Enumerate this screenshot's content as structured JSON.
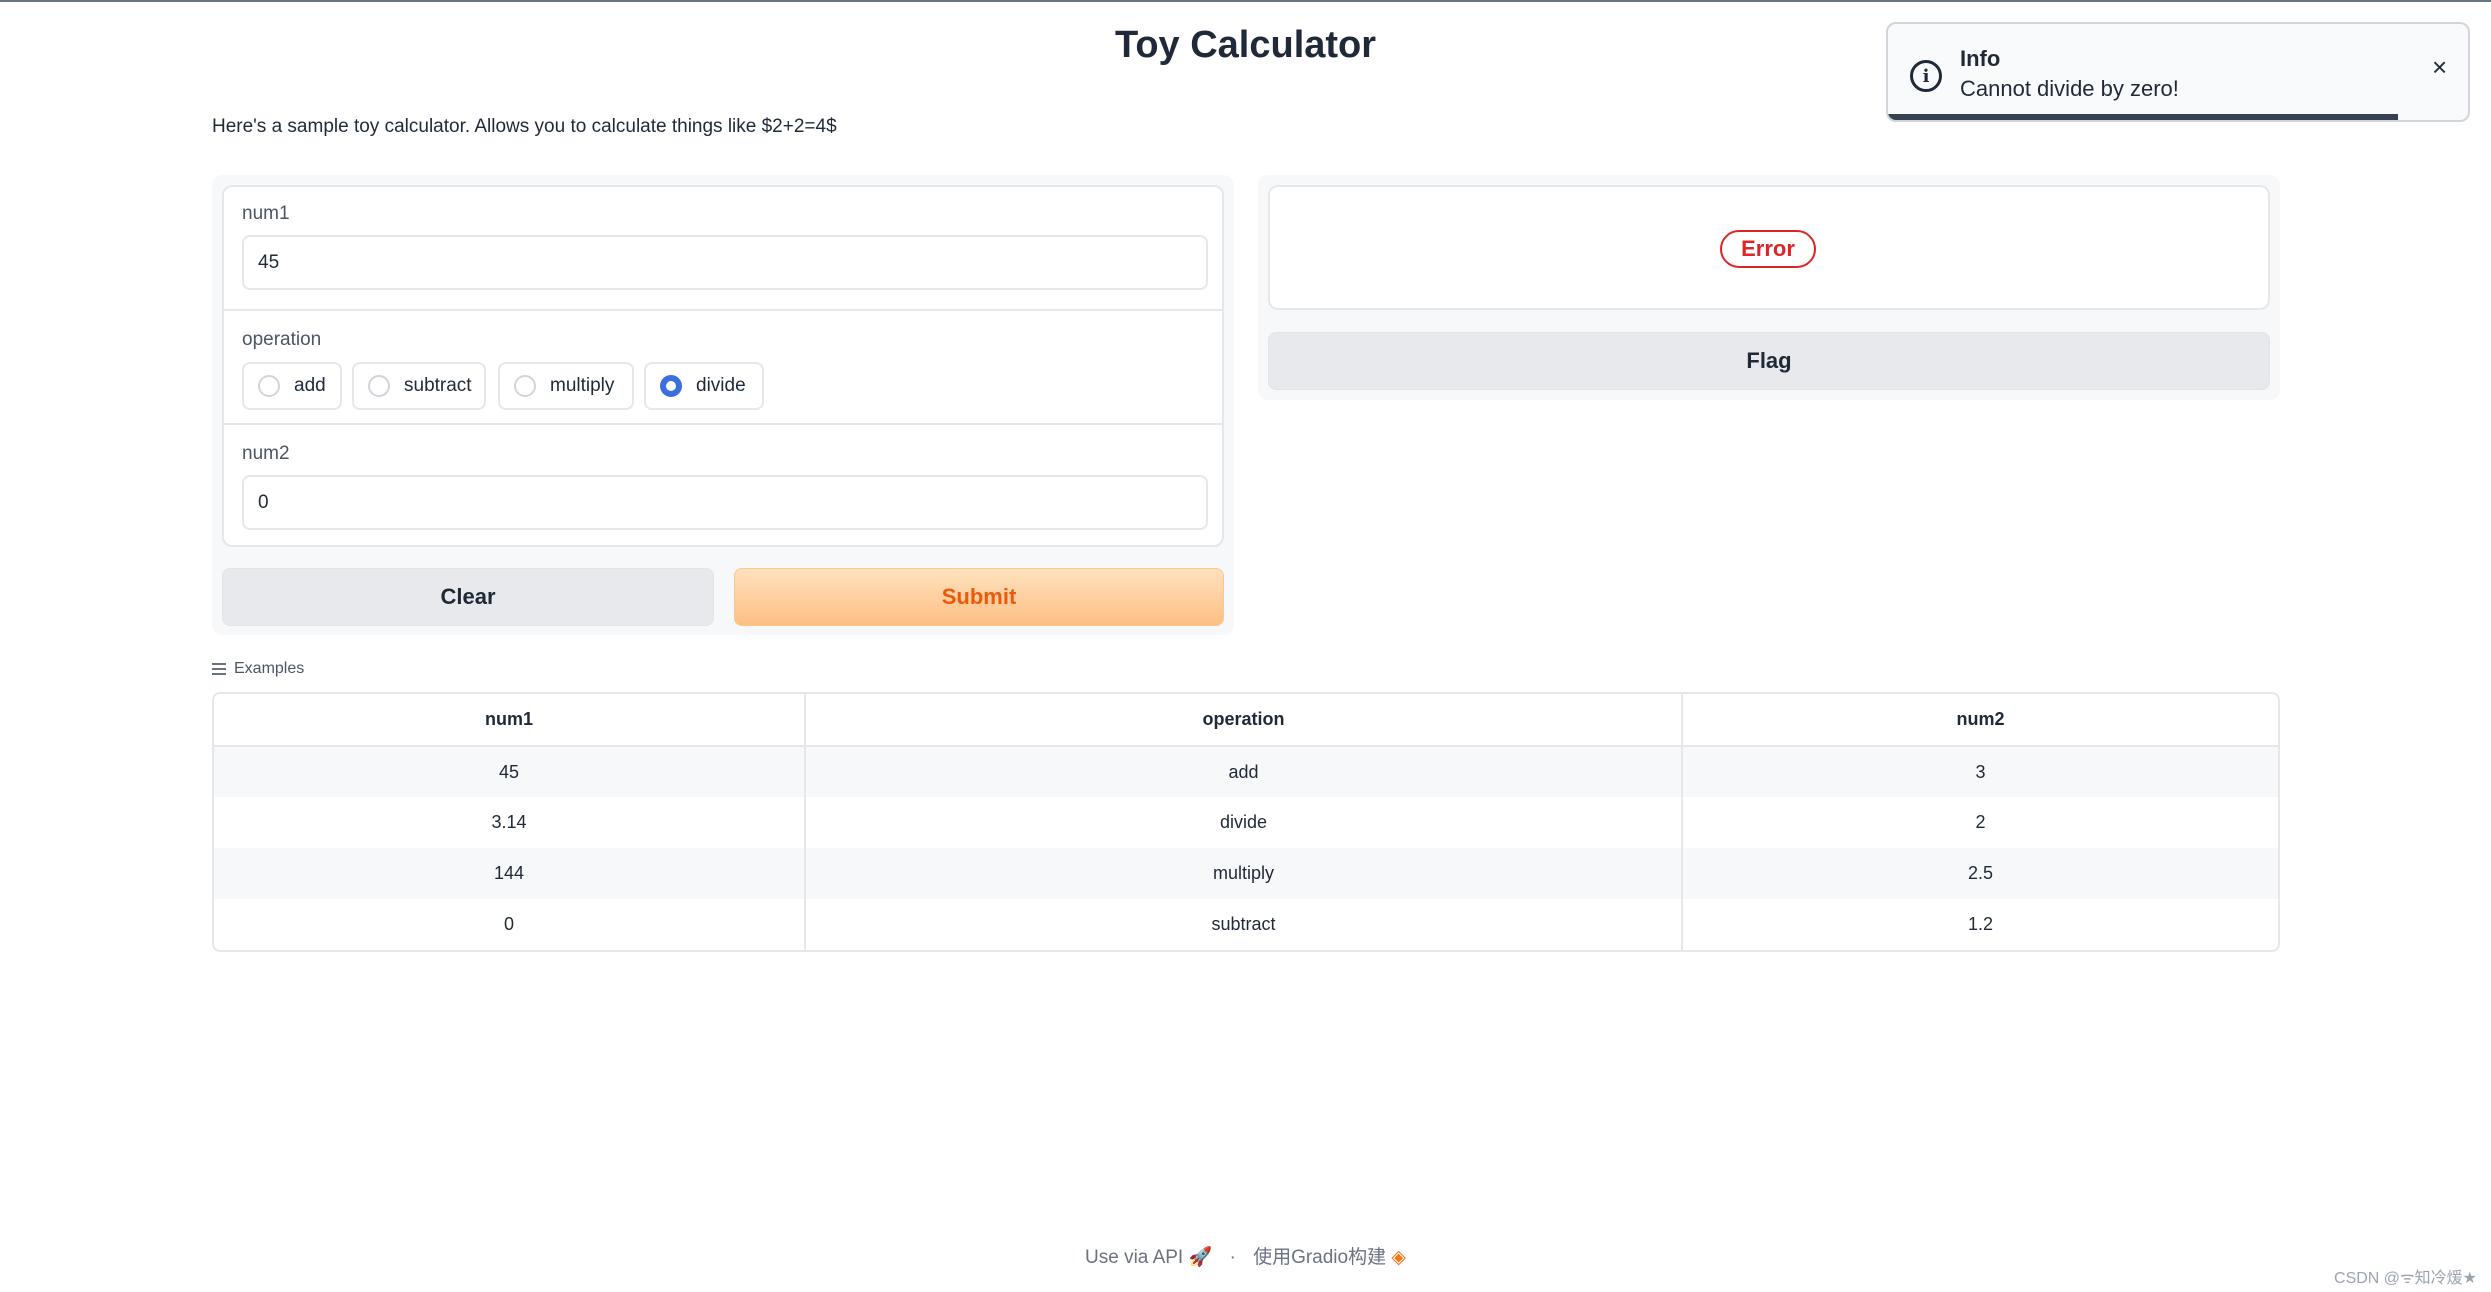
{
  "page": {
    "title": "Toy Calculator",
    "description": "Here's a sample toy calculator. Allows you to calculate things like $2+2=4$"
  },
  "inputs": {
    "num1": {
      "label": "num1",
      "value": "45"
    },
    "operation": {
      "label": "operation",
      "options": [
        "add",
        "subtract",
        "multiply",
        "divide"
      ],
      "selected": "divide"
    },
    "num2": {
      "label": "num2",
      "value": "0"
    }
  },
  "buttons": {
    "clear": "Clear",
    "submit": "Submit",
    "flag": "Flag"
  },
  "output": {
    "error_label": "Error"
  },
  "examples": {
    "label": "Examples",
    "columns": [
      "num1",
      "operation",
      "num2"
    ],
    "rows": [
      [
        "45",
        "add",
        "3"
      ],
      [
        "3.14",
        "divide",
        "2"
      ],
      [
        "144",
        "multiply",
        "2.5"
      ],
      [
        "0",
        "subtract",
        "1.2"
      ]
    ]
  },
  "toast": {
    "title": "Info",
    "message": "Cannot divide by zero!",
    "close_glyph": "×",
    "icon": "info-icon",
    "progress": 0.88
  },
  "footer": {
    "api_link": "Use via API",
    "separator": "·",
    "built_with": "使用Gradio构建"
  },
  "watermark": "CSDN @ᯤ知冷煖★",
  "colors": {
    "accent": "#3b6fe0",
    "submit_text": "#ea5a0c",
    "error": "#dc2626"
  }
}
